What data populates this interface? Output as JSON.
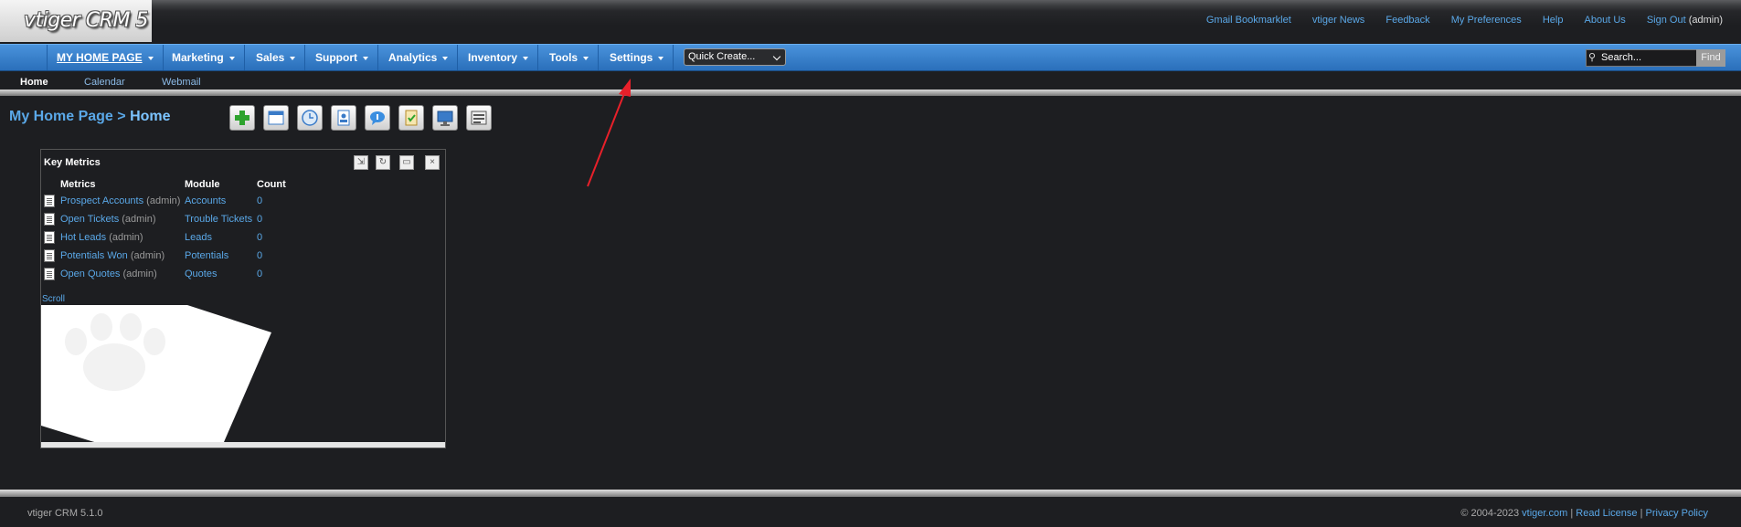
{
  "app": {
    "logo_text": "vtiger CRM 5"
  },
  "toplinks": {
    "items": [
      "Gmail Bookmarklet",
      "vtiger News",
      "Feedback",
      "My Preferences",
      "Help",
      "About Us",
      "Sign Out"
    ],
    "user": "(admin)"
  },
  "nav": {
    "items": [
      "MY HOME PAGE",
      "Marketing",
      "Sales",
      "Support",
      "Analytics",
      "Inventory",
      "Tools",
      "Settings"
    ],
    "quick_create": "Quick Create...",
    "search_placeholder": "Search...",
    "find_label": "Find"
  },
  "subnav": {
    "items": [
      "Home",
      "Calendar",
      "Webmail"
    ]
  },
  "page": {
    "breadcrumb_root": "My Home Page",
    "separator": ">",
    "current": "Home"
  },
  "toolbar": {
    "icons": [
      "add-icon",
      "calendar-icon",
      "clock-icon",
      "contacts-icon",
      "chat-icon",
      "checklist-icon",
      "monitor-icon",
      "notes-icon"
    ]
  },
  "widget": {
    "title": "Key Metrics",
    "headers": [
      "Metrics",
      "Module",
      "Count"
    ],
    "rows": [
      {
        "metric": "Prospect Accounts",
        "owner": "(admin)",
        "module": "Accounts",
        "count": "0"
      },
      {
        "metric": "Open Tickets",
        "owner": "(admin)",
        "module": "Trouble Tickets",
        "count": "0"
      },
      {
        "metric": "Hot Leads",
        "owner": "(admin)",
        "module": "Leads",
        "count": "0"
      },
      {
        "metric": "Potentials Won",
        "owner": "(admin)",
        "module": "Potentials",
        "count": "0"
      },
      {
        "metric": "Open Quotes",
        "owner": "(admin)",
        "module": "Quotes",
        "count": "0"
      }
    ],
    "scroll_label": "Scroll"
  },
  "footer": {
    "version": "vtiger CRM 5.1.0",
    "copyright": "© 2004-2023",
    "site": "vtiger.com",
    "read_license": "Read License",
    "privacy": "Privacy Policy",
    "sep": "|"
  },
  "colors": {
    "accent": "#2a6fba",
    "link": "#5aa8e8",
    "background": "#1d1e21",
    "annotation": "#e8202a"
  }
}
